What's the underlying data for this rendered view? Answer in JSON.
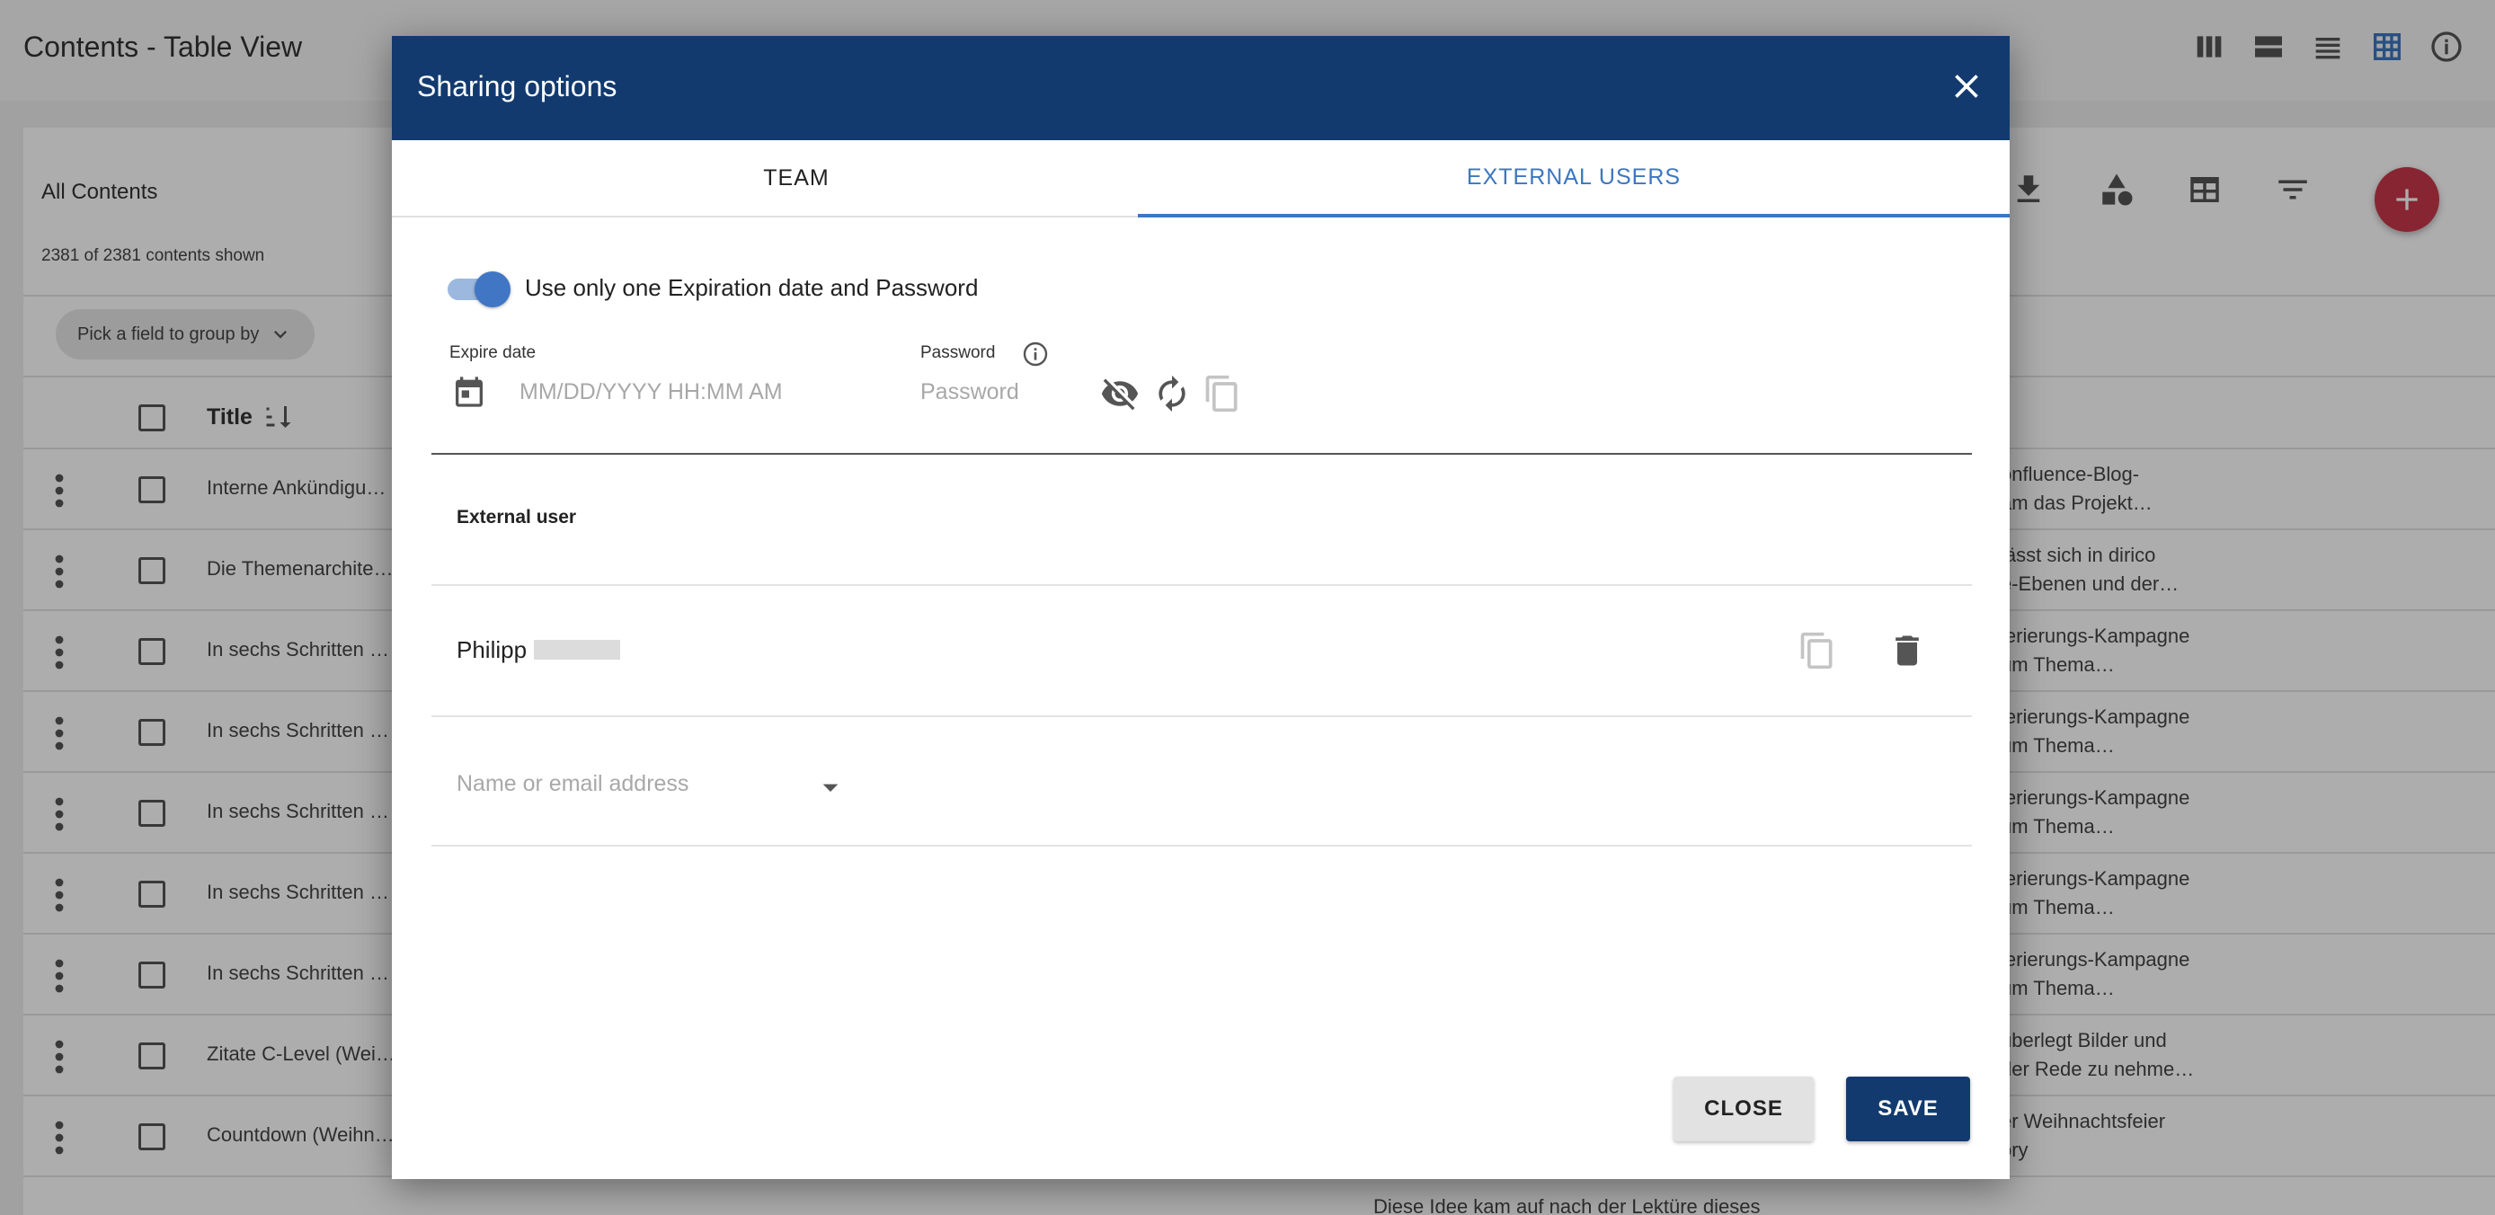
{
  "app": {
    "title": "Contents - Table View",
    "view_icons": [
      "columns-view-icon",
      "card-view-icon",
      "list-view-icon",
      "table-view-icon",
      "info-icon"
    ],
    "active_view": "table-view-icon",
    "accent_color": "#3c77c0",
    "fab_color": "#c8384b"
  },
  "contents": {
    "title": "All Contents",
    "count": "2381 of 2381 contents shown",
    "group_by_label": "Pick a field to group by",
    "column_title": "Title",
    "rows": [
      {
        "title": "Interne Ankündigu…",
        "desc1": "onfluence-Blog-",
        "desc2": "am das Projekt…"
      },
      {
        "title": "Die Themenarchite…",
        "desc1": "lässt sich in dirico",
        "desc2": "e-Ebenen und der…"
      },
      {
        "title": "In sechs Schritten …",
        "desc1": "ierierungs-Kampagne",
        "desc2": "um Thema…"
      },
      {
        "title": "In sechs Schritten …",
        "desc1": "ierierungs-Kampagne",
        "desc2": "um Thema…"
      },
      {
        "title": "In sechs Schritten …",
        "desc1": "ierierungs-Kampagne",
        "desc2": "um Thema…"
      },
      {
        "title": "In sechs Schritten …",
        "desc1": "ierierungs-Kampagne",
        "desc2": "um Thema…"
      },
      {
        "title": "In sechs Schritten …",
        "desc1": "ierierungs-Kampagne",
        "desc2": "um Thema…"
      },
      {
        "title": "Zitate C-Level (Wei…",
        "desc1": "überlegt Bilder und",
        "desc2": "der Rede zu nehme…"
      },
      {
        "title": "Countdown (Weihn…",
        "desc1": "er Weihnachtsfeier",
        "desc2": "ory"
      }
    ],
    "partial_row_text": "Diese Idee kam auf nach der Lektüre dieses"
  },
  "dialog": {
    "title": "Sharing options",
    "header_color": "#123a6e",
    "tabs": [
      {
        "label": "TEAM",
        "active": false
      },
      {
        "label": "EXTERNAL USERS",
        "active": true
      }
    ],
    "toggle_label": "Use only one Expiration date and Password",
    "toggle_on": true,
    "expire_date_label": "Expire date",
    "expire_date_placeholder": "MM/DD/YYYY HH:MM AM",
    "password_label": "Password",
    "password_placeholder": "Password",
    "external_user_header": "External user",
    "users": [
      {
        "name": "Philipp"
      }
    ],
    "name_input_placeholder": "Name or email address",
    "close_label": "CLOSE",
    "save_label": "SAVE"
  }
}
